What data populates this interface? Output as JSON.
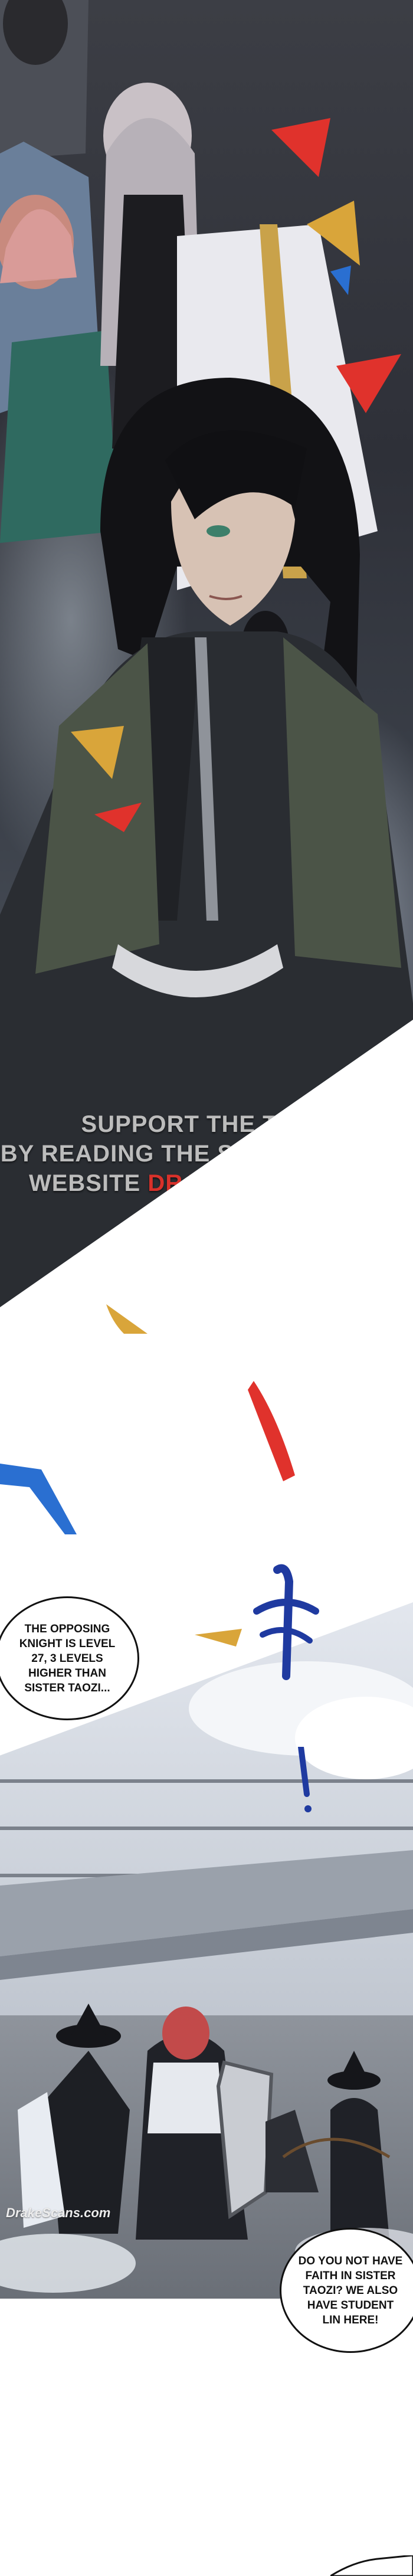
{
  "watermark": {
    "line1": "SUPPORT THE TEAM",
    "line2": "BY READING THE SERIES ON OUR",
    "line3_prefix": "WEBSITE ",
    "line3_site": "DRAKESCANS.COM"
  },
  "panel_logo": {
    "text": "DrakeScans.com"
  },
  "speech": {
    "bubble1": "THE OPPOSING\nKNIGHT IS LEVEL\n27, 3 LEVELS\nHIGHER THAN\nSISTER TAOZI...",
    "bubble2": "DO YOU NOT HAVE\nFAITH IN SISTER\nTAOZI? WE ALSO\nHAVE STUDENT\nLIN HERE!"
  },
  "sfx": {
    "text": "哗"
  },
  "colors": {
    "accent_red": "#d8312a",
    "confetti_red": "#e0322c",
    "confetti_blue": "#2a6fd1",
    "confetti_gold": "#d9a53a"
  }
}
